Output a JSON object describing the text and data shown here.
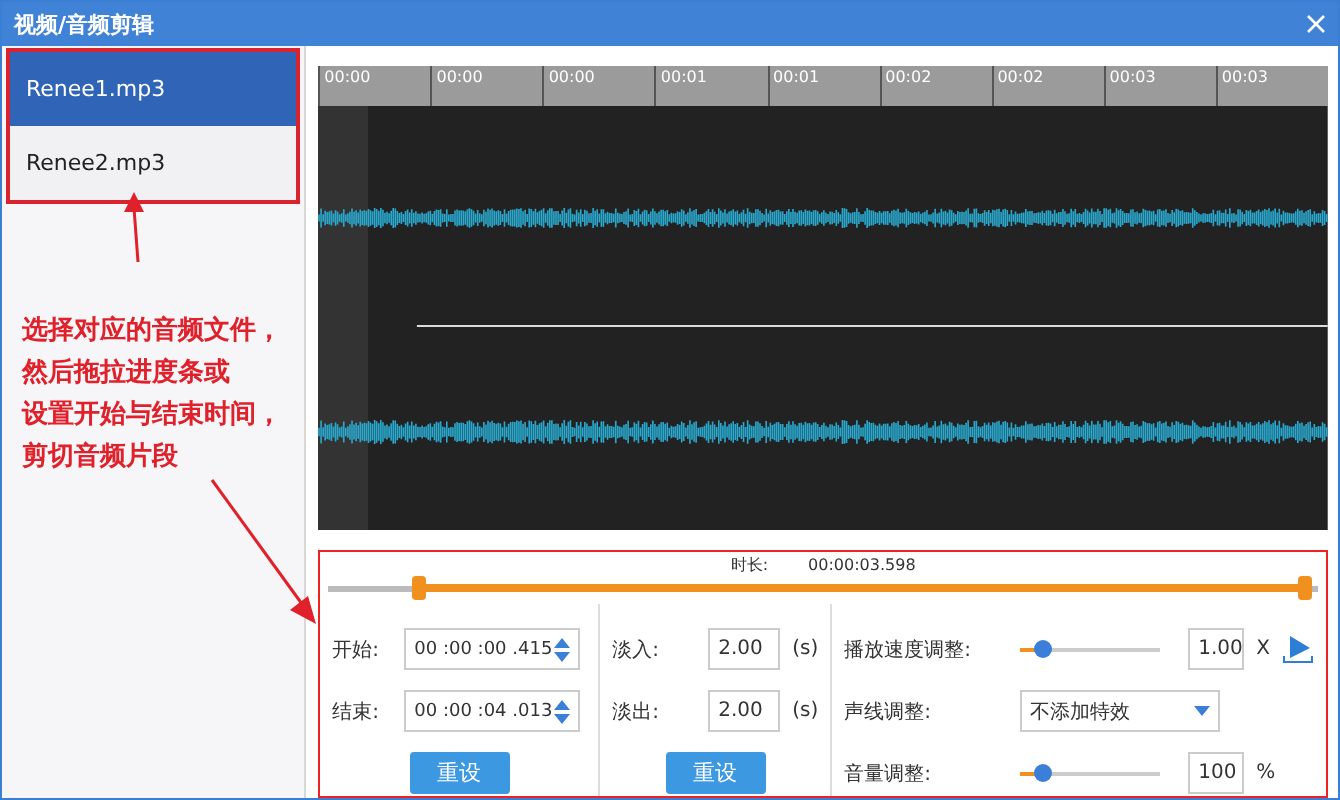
{
  "window": {
    "title": "视频/音频剪辑"
  },
  "files": [
    {
      "name": "Renee1.mp3",
      "selected": true
    },
    {
      "name": "Renee2.mp3",
      "selected": false
    }
  ],
  "annotation": {
    "lines": [
      "选择对应的音频文件，",
      "然后拖拉进度条或",
      "设置开始与结束时间，",
      "剪切音频片段"
    ]
  },
  "ruler": {
    "labels": [
      "00:00",
      "00:00",
      "00:00",
      "00:01",
      "00:01",
      "00:02",
      "00:02",
      "00:03",
      "00:03"
    ]
  },
  "duration": {
    "label": "时长:",
    "value": "00:00:03.598"
  },
  "trim": {
    "start": {
      "level": 0.09
    },
    "end": {
      "level": 0.985
    }
  },
  "time_fields": [
    {
      "label": "开始:",
      "value": "00 :00 :00 .415"
    },
    {
      "label": "结束:",
      "value": "00 :00 :04 .013"
    }
  ],
  "fade_fields": [
    {
      "label": "淡入:",
      "value": "2.00",
      "unit": "(s)"
    },
    {
      "label": "淡出:",
      "value": "2.00",
      "unit": "(s)"
    }
  ],
  "reset_buttons": [
    "重设",
    "重设"
  ],
  "effects": [
    {
      "kind": "slider",
      "label": "播放速度调整:",
      "level": 0.15,
      "value": "1.00",
      "unit": "X",
      "play": true
    },
    {
      "kind": "dropdown",
      "label": "声线调整:",
      "value": "不添加特效"
    },
    {
      "kind": "slider",
      "label": "音量调整:",
      "level": 0.15,
      "value": "100",
      "unit": "%",
      "play": false
    }
  ]
}
